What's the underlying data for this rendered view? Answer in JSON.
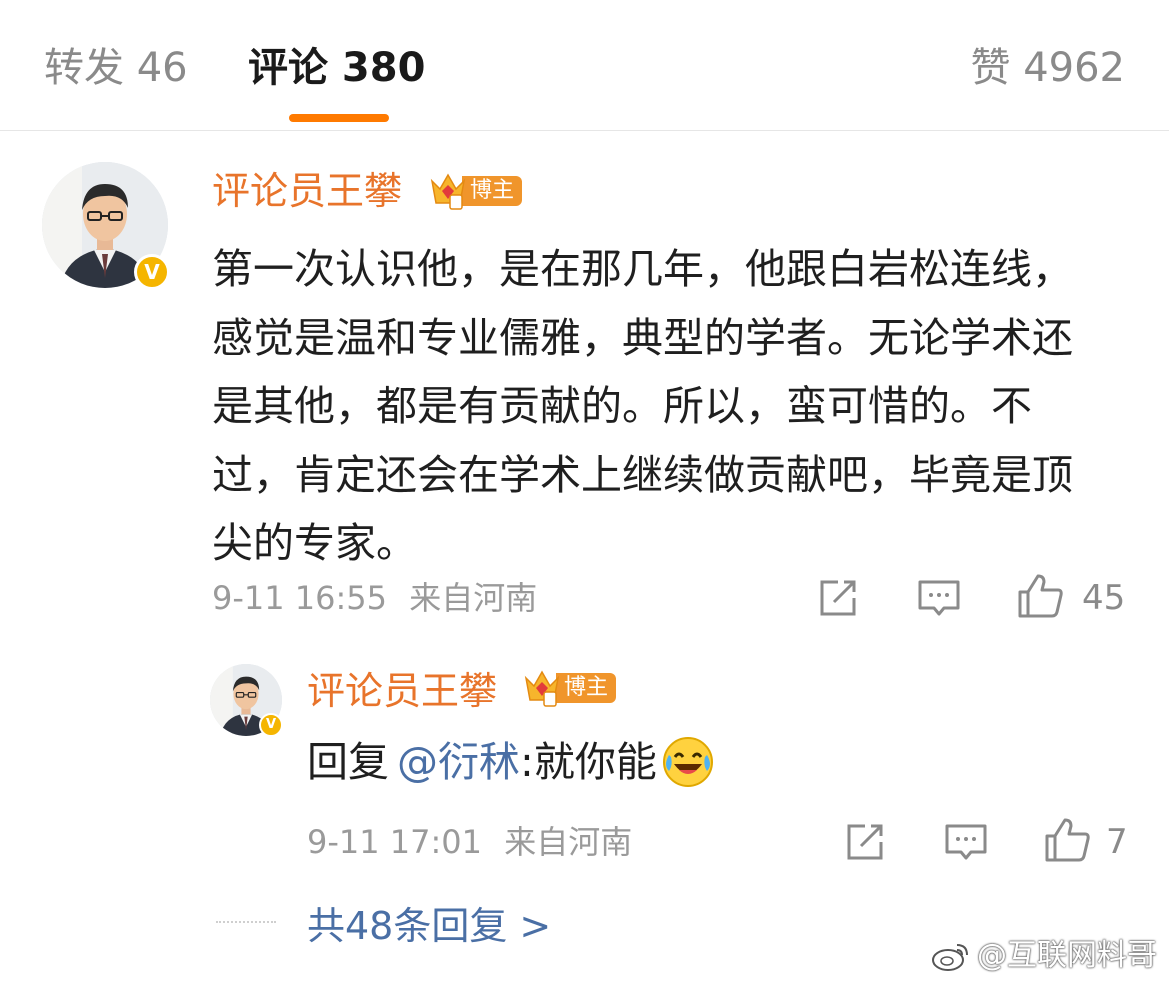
{
  "tabs": {
    "repost": "转发 46",
    "comments": "评论 380",
    "likes": "赞 4962"
  },
  "comment": {
    "username": "评论员王攀",
    "badge": "博主",
    "verify": "V",
    "text": "第一次认识他，是在那几年，他跟白岩松连线，感觉是温和专业儒雅，典型的学者。无论学术还是其他，都是有贡献的。所以，蛮可惜的。不过，肯定还会在学术上继续做贡献吧，毕竟是顶尖的专家。",
    "time": "9-11 16:55",
    "location": "来自河南",
    "likes": "45"
  },
  "reply": {
    "username": "评论员王攀",
    "badge": "博主",
    "verify": "V",
    "prefix": "回复",
    "mention": "@衍秫",
    "text": ":就你能",
    "time": "9-11 17:01",
    "location": "来自河南",
    "likes": "7"
  },
  "more_replies": "共48条回复 >",
  "watermark": "@互联网料哥",
  "icons": {
    "repost": "share-edit-icon",
    "comment": "comment-bubble-icon",
    "like": "thumbs-up-icon",
    "emoji": "laughing-crying-emoji"
  },
  "colors": {
    "username": "#e8742b",
    "accent_underline": "#ff7a00",
    "link": "#4a6fa5",
    "verify": "#f5b500",
    "badge": "#f0952b"
  }
}
